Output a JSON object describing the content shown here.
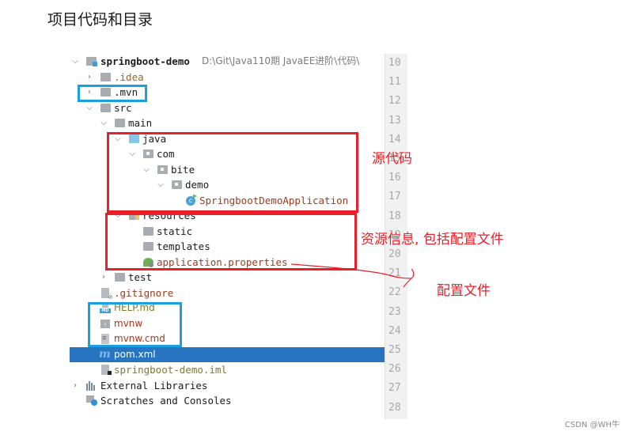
{
  "heading": "项目代码和目录",
  "project_tree": {
    "root": {
      "name": "springboot-demo",
      "path": "D:\\Git\\Java110期 JavaEE进阶\\代码\\"
    },
    "items": [
      {
        "label": ".idea",
        "icon": "folder-icon",
        "state": "collapsed"
      },
      {
        "label": ".mvn",
        "icon": "folder-icon",
        "state": "collapsed"
      },
      {
        "label": "src",
        "icon": "folder-icon",
        "state": "expanded"
      },
      {
        "label": "main",
        "icon": "folder-icon",
        "state": "expanded"
      },
      {
        "label": "java",
        "icon": "source-folder-icon",
        "state": "expanded"
      },
      {
        "label": "com",
        "icon": "package-icon",
        "state": "expanded"
      },
      {
        "label": "bite",
        "icon": "package-icon",
        "state": "expanded"
      },
      {
        "label": "demo",
        "icon": "package-icon",
        "state": "expanded"
      },
      {
        "label": "SpringbootDemoApplication",
        "icon": "spring-class-icon"
      },
      {
        "label": "resources",
        "icon": "resources-folder-icon",
        "state": "expanded"
      },
      {
        "label": "static",
        "icon": "folder-icon"
      },
      {
        "label": "templates",
        "icon": "folder-icon"
      },
      {
        "label": "application.properties",
        "icon": "spring-properties-icon"
      },
      {
        "label": "test",
        "icon": "folder-icon",
        "state": "collapsed"
      },
      {
        "label": ".gitignore",
        "icon": "gitignore-icon"
      },
      {
        "label": "HELP.md",
        "icon": "markdown-icon"
      },
      {
        "label": "mvnw",
        "icon": "shell-script-icon"
      },
      {
        "label": "mvnw.cmd",
        "icon": "text-file-icon"
      },
      {
        "label": "pom.xml",
        "icon": "maven-icon",
        "selected": true
      },
      {
        "label": "springboot-demo.iml",
        "icon": "iml-file-icon"
      },
      {
        "label": "External Libraries",
        "icon": "libraries-icon",
        "state": "collapsed"
      },
      {
        "label": "Scratches and Consoles",
        "icon": "scratches-icon"
      }
    ]
  },
  "line_numbers": [
    "10",
    "11",
    "12",
    "13",
    "14",
    "15",
    "16",
    "17",
    "18",
    "19",
    "20",
    "21",
    "22",
    "23",
    "24",
    "25",
    "26",
    "27",
    "28"
  ],
  "annotations": {
    "source_code": "源代码",
    "resources": "资源信息, 包括配置文件",
    "config_file": "配置文件"
  },
  "colors": {
    "selection": "#2775c0",
    "annotation_red": "#e8202a",
    "annotation_blue": "#1a9fe0"
  },
  "watermark": "CSDN @WH牛"
}
